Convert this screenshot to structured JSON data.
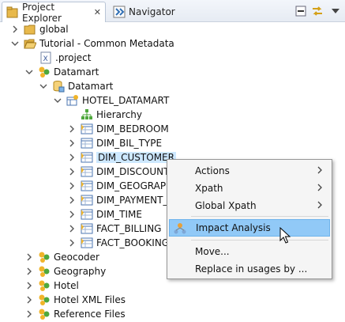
{
  "tabs": [
    {
      "label": "Project Explorer",
      "close": "✕"
    },
    {
      "label": "Navigator"
    }
  ],
  "tree": {
    "global": "global",
    "tutorial": "Tutorial - Common Metadata",
    "project_file": ".project",
    "datamart_folder": "Datamart",
    "datamart_db": "Datamart",
    "hotel_datamart": "HOTEL_DATAMART",
    "hierarchy": "Hierarchy",
    "tables": [
      "DIM_BEDROOM",
      "DIM_BIL_TYPE",
      "DIM_CUSTOMER",
      "DIM_DISCOUNT",
      "DIM_GEOGRAPH",
      "DIM_PAYMENT_",
      "DIM_TIME",
      "FACT_BILLING",
      "FACT_BOOKING"
    ],
    "folders_after": [
      "Geocoder",
      "Geography",
      "Hotel",
      "Hotel XML Files",
      "Reference Files"
    ]
  },
  "context_menu": {
    "actions": "Actions",
    "xpath": "Xpath",
    "global_xpath": "Global Xpath",
    "impact_analysis": "Impact Analysis",
    "move": "Move...",
    "replace": "Replace in usages by ..."
  },
  "icons": {
    "project_explorer": "project-explorer-icon",
    "navigator": "navigator-icon",
    "minimize": "minimize-icon",
    "link": "link-with-editor-icon",
    "menu": "view-menu-icon"
  },
  "colors": {
    "selection": "#cde8ff",
    "menu_highlight": "#91c9f7",
    "folder": "#e8b94b"
  }
}
